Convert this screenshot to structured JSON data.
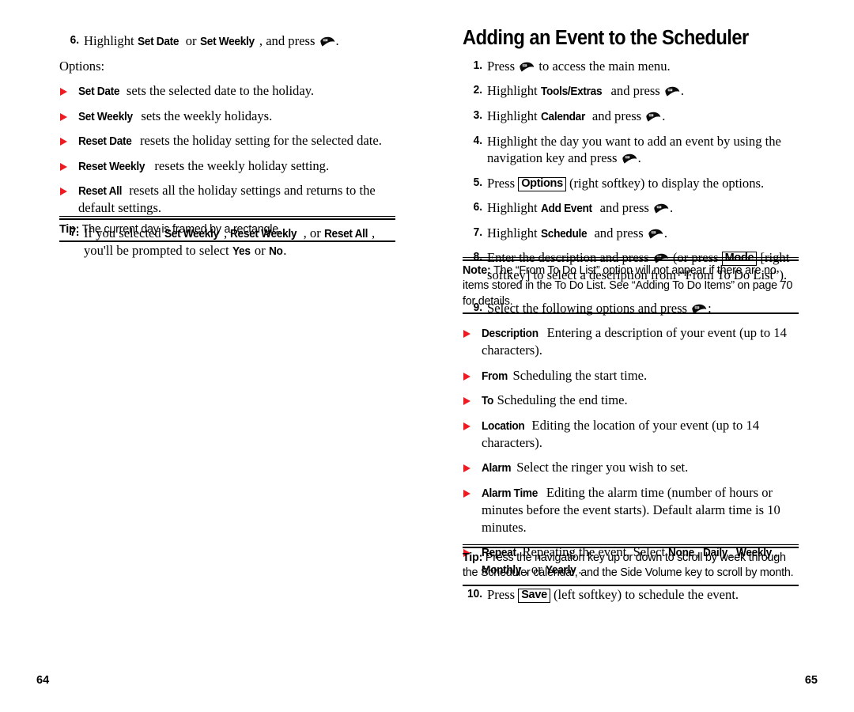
{
  "document": {
    "type": "user-manual-spread",
    "accent_color": "#ee1b22",
    "text_color": "#000000",
    "background_color": "#ffffff"
  },
  "left_page": {
    "folio": "64",
    "step6": {
      "num": "6.",
      "pre": "Highlight ",
      "ui1": "Set Date",
      "mid": " or ",
      "ui2": "Set Weekly",
      "post": ", and press ",
      "end": "."
    },
    "options_label": "Options:",
    "options": [
      {
        "term": "Set Date",
        "desc": " sets the selected date to the holiday."
      },
      {
        "term": "Set Weekly",
        "desc": " sets the weekly holidays."
      },
      {
        "term": "Reset Date",
        "desc": " resets the holiday setting for the selected date."
      },
      {
        "term": "Reset Weekly",
        "desc": " resets the weekly holiday setting."
      },
      {
        "term": "Reset All",
        "desc": " resets all the holiday settings and returns to the default settings."
      }
    ],
    "step7": {
      "num": "7.",
      "pre": "If you selected ",
      "ui1": "Set Weekly",
      "sep1": ", ",
      "ui2": "Reset Weekly",
      "sep2": ", or ",
      "ui3": "Reset All",
      "mid": ", you'll be prompted to select ",
      "ui4": "Yes",
      "sep3": " or ",
      "ui5": "No",
      "end": "."
    },
    "tip": {
      "label": "Tip:",
      "text": " The current day is framed by a rectangle."
    }
  },
  "right_page": {
    "folio": "65",
    "title": "Adding an Event to the Scheduler",
    "step1": {
      "num": "1.",
      "pre": "Press ",
      "post": " to access the main menu."
    },
    "step2": {
      "num": "2.",
      "pre": "Highlight ",
      "ui": "Tools/Extras",
      "mid": " and press ",
      "end": "."
    },
    "step3": {
      "num": "3.",
      "pre": "Highlight ",
      "ui": "Calendar",
      "mid": " and press ",
      "end": "."
    },
    "step4": {
      "num": "4.",
      "pre": "Highlight the day you want to add an event by using the navigation key and press ",
      "end": "."
    },
    "step5": {
      "num": "5.",
      "pre": "Press ",
      "key": "Options",
      "post": " (right softkey) to display the options."
    },
    "step6": {
      "num": "6.",
      "pre": "Highlight ",
      "ui": "Add Event",
      "mid": " and press ",
      "end": "."
    },
    "step7": {
      "num": "7.",
      "pre": "Highlight ",
      "ui": "Schedule",
      "mid": " and press ",
      "end": "."
    },
    "step8": {
      "num": "8.",
      "pre": "Enter the description and press ",
      "mid": " (or press ",
      "key": "Mode",
      "post": " [right softkey] to select a description from “From To Do List”)."
    },
    "note": {
      "label": "Note:",
      "text": " The “From To Do List” option will not appear if there are no items stored in the To Do List. See “Adding To Do Items” on page 70 for details."
    },
    "step9": {
      "num": "9.",
      "pre": "Select the following options and press ",
      "end": ":"
    },
    "options": [
      {
        "term": "Description",
        "desc": " Entering a description of your event (up to 14 characters)."
      },
      {
        "term": "From",
        "desc": " Scheduling the start time."
      },
      {
        "term": "To",
        "desc": " Scheduling the end time."
      },
      {
        "term": "Location",
        "desc": " Editing the location of your event (up to 14 characters)."
      },
      {
        "term": "Alarm",
        "desc": " Select the ringer you wish to set."
      },
      {
        "term": "Alarm Time",
        "desc": " Editing the alarm time (number of hours or minutes before the event starts). Default alarm time is 10 minutes."
      }
    ],
    "repeat_option": {
      "term": "Repeat",
      "pre": " Repeating the event. Select ",
      "v1": "None",
      "s1": ", ",
      "v2": "Daily",
      "s2": ", ",
      "v3": "Weekly",
      "s3": ", ",
      "v4": "Monthly",
      "s4": ", or ",
      "v5": "Yearly",
      "end": "."
    },
    "step10": {
      "num": "10.",
      "pre": "Press ",
      "key": "Save",
      "post": " (left softkey) to schedule the event."
    },
    "tip": {
      "label": "Tip:",
      "text": " Press the navigation key up or down to scroll by week through the Scheduler calendar, and the Side Volume key to scroll by month."
    }
  },
  "icons": {
    "select_key": "phone-select-key-icon"
  }
}
